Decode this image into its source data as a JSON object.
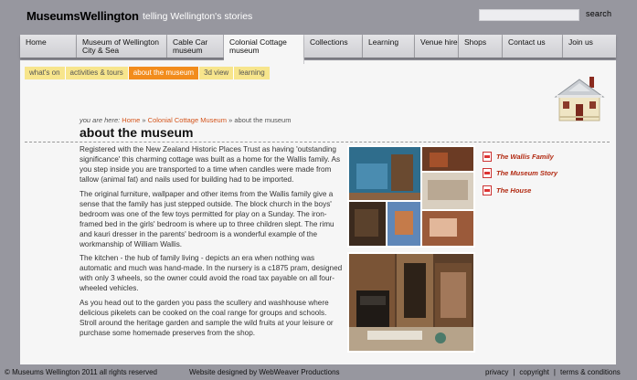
{
  "header": {
    "logo": "MuseumsWellington",
    "tagline": "telling Wellington's stories",
    "search_label": "search"
  },
  "main_nav": [
    {
      "label": "Home"
    },
    {
      "label": "Museum of Wellington City & Sea"
    },
    {
      "label": "Cable Car museum"
    },
    {
      "label": "Colonial Cottage museum",
      "active": true
    },
    {
      "label": "Collections"
    },
    {
      "label": "Learning"
    },
    {
      "label": "Venue hire"
    },
    {
      "label": "Shops"
    },
    {
      "label": "Contact us"
    },
    {
      "label": "Join us"
    }
  ],
  "sub_nav": [
    {
      "label": "what's on"
    },
    {
      "label": "activities & tours"
    },
    {
      "label": "about the museum",
      "active": true
    },
    {
      "label": "3d view"
    },
    {
      "label": "learning"
    }
  ],
  "breadcrumb": {
    "label": "you are here:",
    "home": "Home",
    "sep": "»",
    "section": "Colonial Cottage Museum",
    "current": "about the museum"
  },
  "page_title": "about the museum",
  "paragraphs": [
    "Registered with the New Zealand Historic Places Trust as having 'outstanding significance' this charming cottage was built as a home for the Wallis family. As you step inside you are transported to a time when candles were made from tallow (animal fat) and nails used for building had to be imported.",
    "The original furniture, wallpaper and other items from the Wallis family give a sense that the family has just stepped outside. The block church in the boys' bedroom was one of the few toys permitted for play on a Sunday. The iron-framed bed in the girls' bedroom is where up to three children slept. The rimu and kauri dresser in the parents' bedroom is a wonderful example of the workmanship of William Wallis.",
    "The kitchen - the hub of family living - depicts an era when nothing was automatic and much was hand-made. In the nursery is a c1875 pram, designed with only 3 wheels, so the owner could avoid the road tax payable on all four-wheeled vehicles.",
    "As you head out to the garden you pass the scullery and washhouse where delicious pikelets can be cooked on the coal range for groups and schools. Stroll around the heritage garden and sample the wild fruits at your leisure or purchase some homemade preserves from the shop."
  ],
  "side_links": [
    {
      "label": "The Wallis Family",
      "icon": "pdf-icon"
    },
    {
      "label": "The Museum Story",
      "icon": "pdf-icon"
    },
    {
      "label": "The House",
      "icon": "pdf-icon"
    }
  ],
  "footer": {
    "copyright": "© Museums Wellington 2011 all rights reserved",
    "credit": "Website designed by WebWeaver Productions",
    "links": [
      "privacy",
      "copyright",
      "terms & conditions"
    ],
    "sep": "|"
  },
  "colors": {
    "background": "#97979f",
    "panel": "#f6f6f6",
    "subnav": "#f7e58c",
    "subnav_active": "#f28c1c",
    "link": "#d4541b",
    "pdf_link": "#b22a12"
  }
}
